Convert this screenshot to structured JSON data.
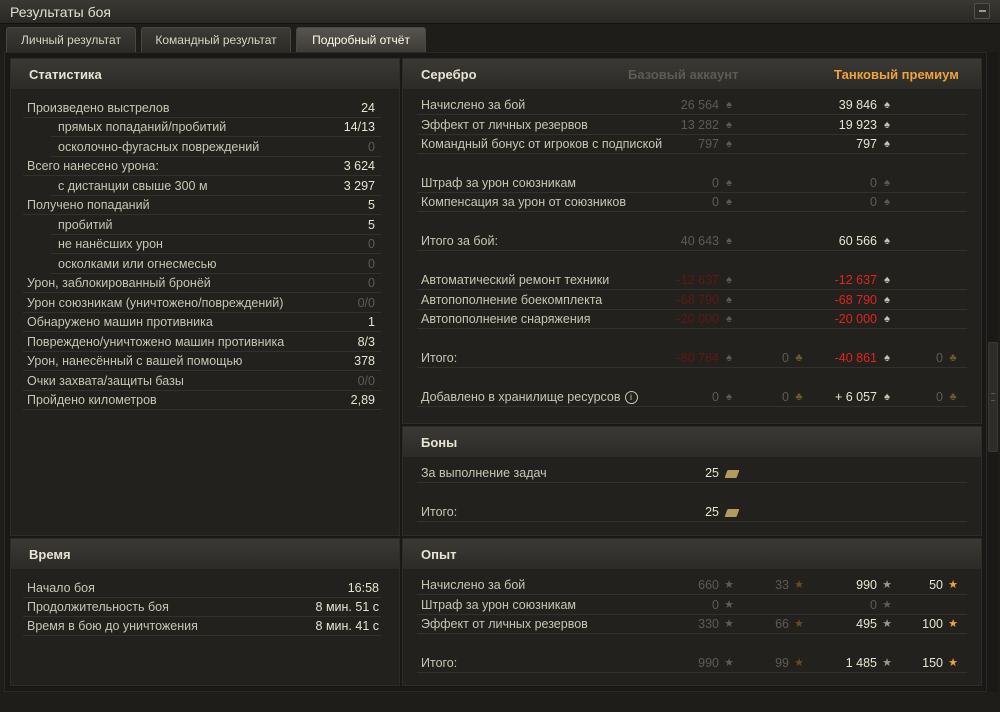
{
  "window": {
    "title": "Результаты боя"
  },
  "tabs": [
    {
      "label": "Личный результат",
      "active": false
    },
    {
      "label": "Командный результат",
      "active": false
    },
    {
      "label": "Подробный отчёт",
      "active": true
    }
  ],
  "stats": {
    "title": "Статистика",
    "rows": [
      {
        "label": "Произведено выстрелов",
        "value": "24",
        "indent": false,
        "dim": false
      },
      {
        "label": "прямых попаданий/пробитий",
        "value": "14/13",
        "indent": true,
        "dim": false
      },
      {
        "label": "осколочно-фугасных повреждений",
        "value": "0",
        "indent": true,
        "dim": true
      },
      {
        "label": "Всего нанесено урона:",
        "value": "3 624",
        "indent": false,
        "dim": false
      },
      {
        "label": "с дистанции свыше 300 м",
        "value": "3 297",
        "indent": true,
        "dim": false
      },
      {
        "label": "Получено попаданий",
        "value": "5",
        "indent": false,
        "dim": false
      },
      {
        "label": "пробитий",
        "value": "5",
        "indent": true,
        "dim": false
      },
      {
        "label": "не нанёсших урон",
        "value": "0",
        "indent": true,
        "dim": true
      },
      {
        "label": "осколками или огнесмесью",
        "value": "0",
        "indent": true,
        "dim": true
      },
      {
        "label": "Урон, заблокированный бронёй",
        "value": "0",
        "indent": false,
        "dim": true
      },
      {
        "label": "Урон союзникам (уничтожено/повреждений)",
        "value": "0/0",
        "indent": false,
        "dim": true
      },
      {
        "label": "Обнаружено машин противника",
        "value": "1",
        "indent": false,
        "dim": false
      },
      {
        "label": "Повреждено/уничтожено машин противника",
        "value": "8/3",
        "indent": false,
        "dim": false
      },
      {
        "label": "Урон, нанесённый с вашей помощью",
        "value": "378",
        "indent": false,
        "dim": false
      },
      {
        "label": "Очки захвата/защиты базы",
        "value": "0/0",
        "indent": false,
        "dim": true
      },
      {
        "label": "Пройдено километров",
        "value": "2,89",
        "indent": false,
        "dim": false
      }
    ]
  },
  "time": {
    "title": "Время",
    "rows": [
      {
        "label": "Начало боя",
        "value": "16:58"
      },
      {
        "label": "Продолжительность боя",
        "value": "8 мин. 51 с"
      },
      {
        "label": "Время в бою до уничтожения",
        "value": "8 мин. 41 с"
      }
    ]
  },
  "silver": {
    "title": "Серебро",
    "col_base": "Базовый аккаунт",
    "col_premium": "Танковый премиум",
    "rows": [
      {
        "label": "Начислено за бой",
        "base": "26 564",
        "prem": "39 846",
        "base2": "",
        "prem2": "",
        "style": "normal"
      },
      {
        "label": "Эффект от личных резервов",
        "base": "13 282",
        "prem": "19 923",
        "base2": "",
        "prem2": "",
        "style": "normal"
      },
      {
        "label": "Командный бонус от игроков с подпиской",
        "base": "797",
        "prem": "797",
        "base2": "",
        "prem2": "",
        "style": "normal"
      },
      {
        "label": "Штраф за урон союзникам",
        "base": "0",
        "prem": "0",
        "base2": "",
        "prem2": "",
        "style": "zero"
      },
      {
        "label": "Компенсация за урон от союзников",
        "base": "0",
        "prem": "0",
        "base2": "",
        "prem2": "",
        "style": "zero"
      },
      {
        "label": "Итого за бой:",
        "base": "40 643",
        "prem": "60 566",
        "base2": "",
        "prem2": "",
        "style": "normal"
      },
      {
        "label": "Автоматический ремонт техники",
        "base": "-12 637",
        "prem": "-12 637",
        "base2": "",
        "prem2": "",
        "style": "red"
      },
      {
        "label": "Автопополнение боекомплекта",
        "base": "-68 790",
        "prem": "-68 790",
        "base2": "",
        "prem2": "",
        "style": "red"
      },
      {
        "label": "Автопополнение снаряжения",
        "base": "-20 000",
        "prem": "-20 000",
        "base2": "",
        "prem2": "",
        "style": "red"
      },
      {
        "label": "Итого:",
        "base": "-80 784",
        "prem": "-40 861",
        "base2": "0",
        "prem2": "0",
        "style": "red"
      },
      {
        "label": "Добавлено в хранилище ресурсов",
        "base": "0",
        "prem": "+ 6 057",
        "base2": "0",
        "prem2": "0",
        "style": "storage"
      }
    ]
  },
  "bonds": {
    "title": "Боны",
    "rows": [
      {
        "label": "За выполнение задач",
        "value": "25"
      },
      {
        "label": "Итого:",
        "value": "25"
      }
    ]
  },
  "exp": {
    "title": "Опыт",
    "rows": [
      {
        "label": "Начислено за бой",
        "base": "660",
        "base_free": "33",
        "prem": "990",
        "prem_free": "50"
      },
      {
        "label": "Штраф за урон союзникам",
        "base": "0",
        "base_free": "",
        "prem": "0",
        "prem_free": ""
      },
      {
        "label": "Эффект от личных резервов",
        "base": "330",
        "base_free": "66",
        "prem": "495",
        "prem_free": "100"
      },
      {
        "label": "Итого:",
        "base": "990",
        "base_free": "99",
        "prem": "1 485",
        "prem_free": "150"
      }
    ]
  },
  "icons": {
    "credits": "silver-coin-icon",
    "gold": "gold-icon",
    "bond": "bond-icon",
    "xp": "star-icon",
    "free_xp": "free-xp-star-icon",
    "info": "info-icon"
  },
  "info_glyph": "i"
}
